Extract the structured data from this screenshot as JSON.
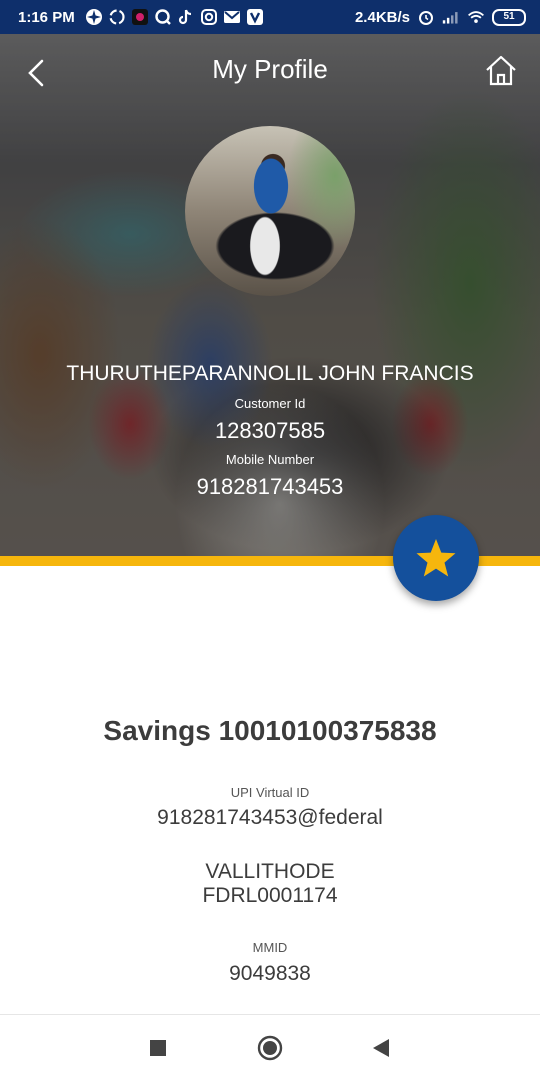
{
  "status_bar": {
    "time": "1:16 PM",
    "network_speed": "2.4KB/s",
    "battery": "51",
    "icons": [
      "fan-icon",
      "sync-icon",
      "app-icon",
      "q-icon",
      "tiktok-icon",
      "instagram-icon",
      "gmail-icon",
      "v-icon",
      "alarm-icon",
      "signal-icon",
      "wifi-icon"
    ]
  },
  "header": {
    "title": "My Profile",
    "back_icon": "chevron-left-icon",
    "home_icon": "home-icon"
  },
  "profile": {
    "name": "THURUTHEPARANNOLIL JOHN FRANCIS",
    "customer_id_label": "Customer Id",
    "customer_id": "128307585",
    "mobile_label": "Mobile Number",
    "mobile": "918281743453"
  },
  "favorite_icon": "star-icon",
  "colors": {
    "status_bar": "#0e2f6b",
    "accent_yellow": "#f6b60d",
    "fab_blue": "#14509c",
    "star": "#f6b60d"
  },
  "account": {
    "title": "Savings 10010100375838",
    "upi_label": "UPI Virtual ID",
    "upi_id": "918281743453@federal",
    "branch": "VALLITHODE",
    "ifsc": "FDRL0001174",
    "mmid_label": "MMID",
    "mmid": "9049838"
  },
  "navbar": {
    "items": [
      "recents-icon",
      "home-circle-icon",
      "back-triangle-icon"
    ]
  }
}
